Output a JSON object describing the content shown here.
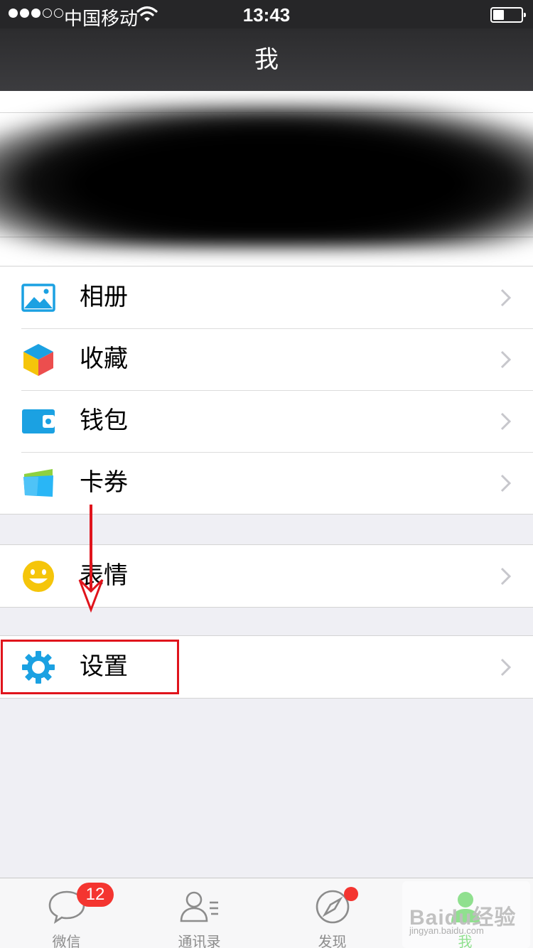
{
  "status_bar": {
    "carrier": "中国移动",
    "time": "13:43",
    "signal_bars_filled": 3,
    "signal_bars_total": 5,
    "battery_level": 0.4
  },
  "nav": {
    "title": "我"
  },
  "menu_group_1": [
    {
      "label": "相册",
      "icon": "photo-album-icon"
    },
    {
      "label": "收藏",
      "icon": "favorites-cube-icon"
    },
    {
      "label": "钱包",
      "icon": "wallet-icon"
    },
    {
      "label": "卡券",
      "icon": "card-coupon-icon"
    }
  ],
  "menu_group_2": [
    {
      "label": "表情",
      "icon": "emoji-smile-icon"
    }
  ],
  "menu_group_3": [
    {
      "label": "设置",
      "icon": "settings-gear-icon"
    }
  ],
  "tab_bar": [
    {
      "label": "微信",
      "icon": "chat-bubble-icon",
      "badge": "12"
    },
    {
      "label": "通讯录",
      "icon": "contacts-icon"
    },
    {
      "label": "发现",
      "icon": "compass-icon",
      "dot": true
    },
    {
      "label": "我",
      "icon": "me-person-icon",
      "active": true
    }
  ],
  "watermark": {
    "text": "Baidu经验",
    "url": "jingyan.baidu.com"
  },
  "colors": {
    "accent_green": "#09bb07",
    "badge_red": "#f43530",
    "annotation_red": "#e0141c",
    "nav_dark": "#2c2c2e"
  }
}
